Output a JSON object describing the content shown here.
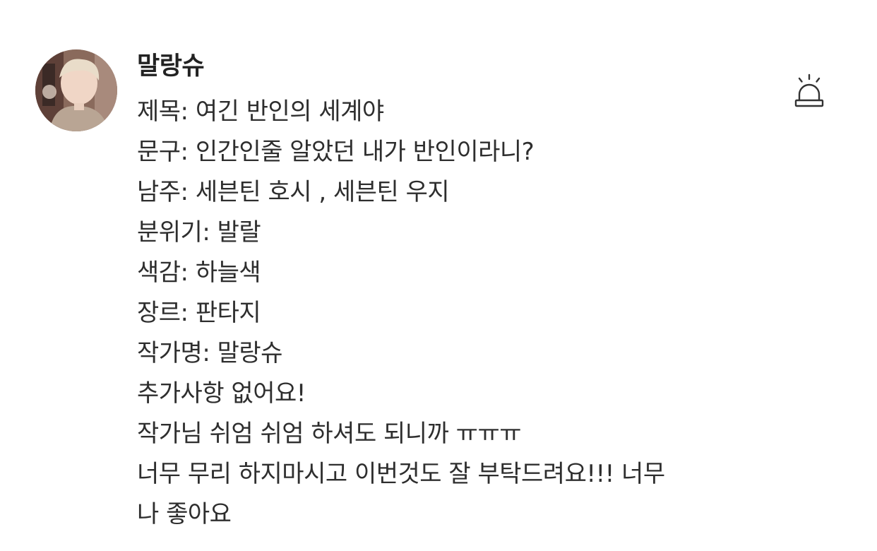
{
  "comment": {
    "author": "말랑슈",
    "avatar_icon": "profile-photo",
    "report_icon": "siren-alarm-icon",
    "lines": [
      "제목: 여긴 반인의 세계야",
      "문구: 인간인줄 알았던 내가 반인이라니?",
      "남주: 세븐틴 호시 , 세븐틴 우지",
      "분위기: 발랄",
      "색감: 하늘색",
      "장르: 판타지",
      "작가명: 말랑슈",
      "추가사항 없어요!",
      "작가님 쉬엄 쉬엄 하셔도 되니까 ㅠㅠㅠ",
      "너무 무리 하지마시고 이번것도 잘 부탁드려요!!! 너무",
      "나 좋아요"
    ]
  }
}
